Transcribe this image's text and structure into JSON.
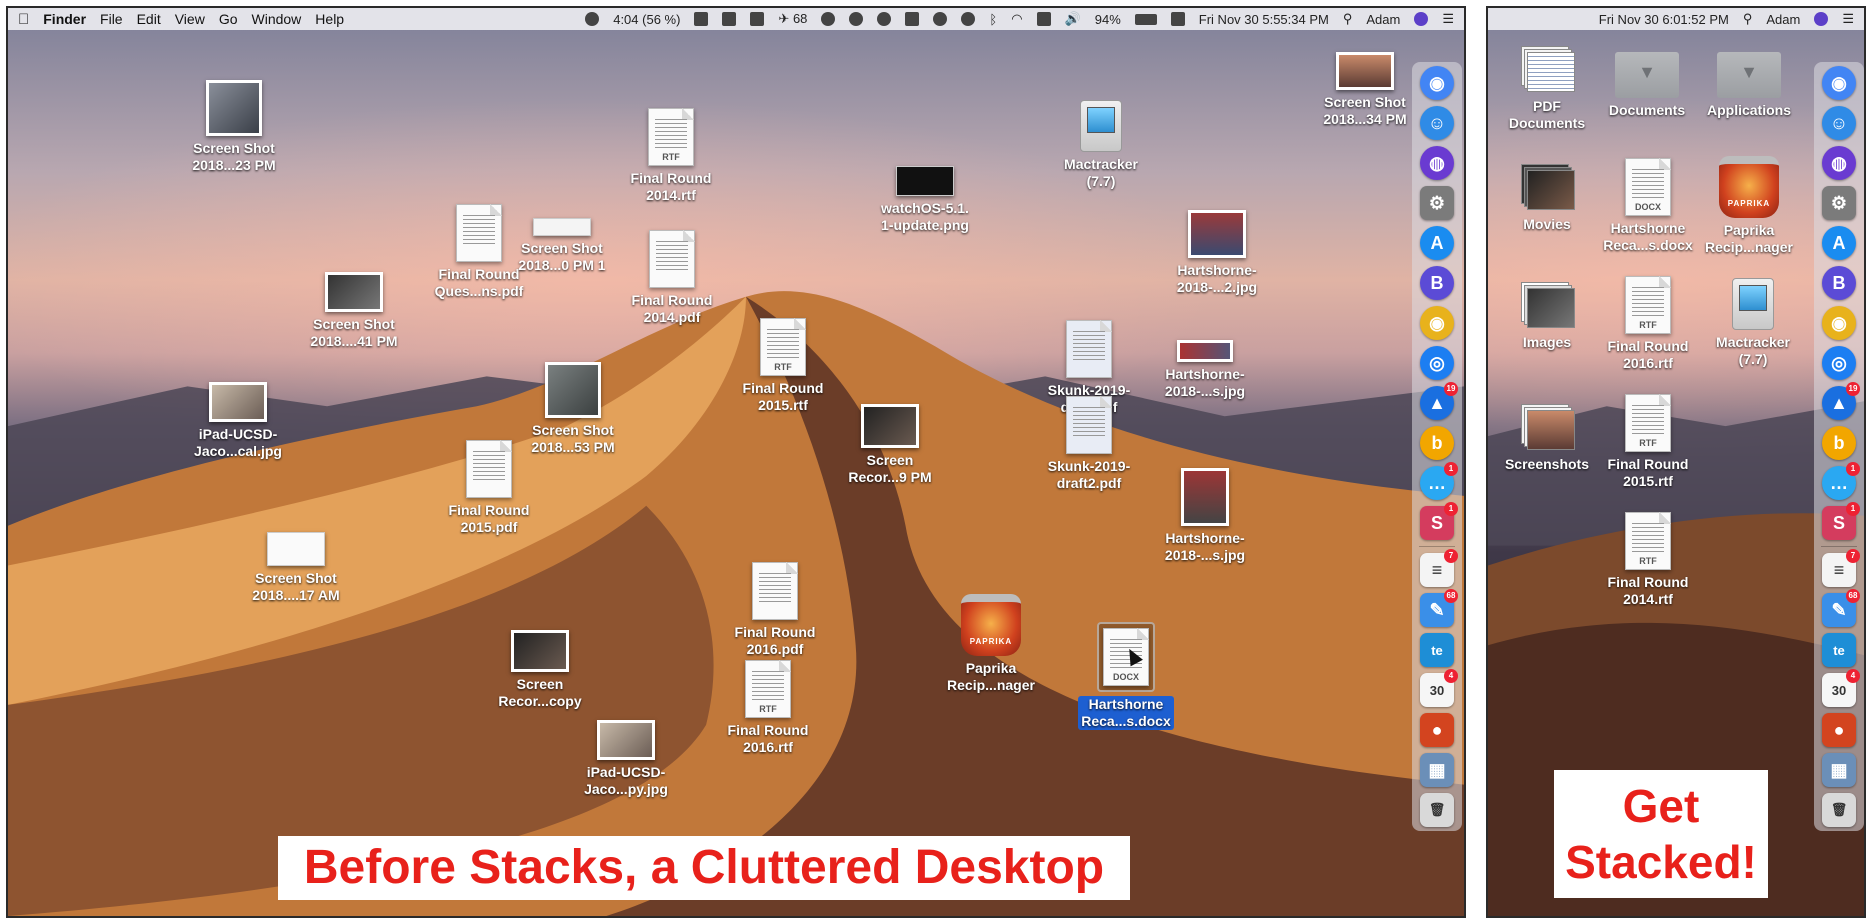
{
  "left_screen": {
    "menubar": {
      "app_name": "Finder",
      "menus": [
        "File",
        "Edit",
        "View",
        "Go",
        "Window",
        "Help"
      ],
      "battery_timer": "4:04 (56 %)",
      "flight_count": "68",
      "battery_percent": "94%",
      "clock": "Fri Nov 30  5:55:34 PM",
      "user": "Adam"
    },
    "desktop_items": [
      {
        "label": "Screen Shot\n2018...23 PM",
        "kind": "photo"
      },
      {
        "label": "Final Round\nQues...ns.pdf",
        "kind": "doc"
      },
      {
        "label": "Screen Shot\n2018...0 PM 1",
        "kind": "screenshot"
      },
      {
        "label": "Final Round\n2014.rtf",
        "kind": "doc",
        "tag": "RTF"
      },
      {
        "label": "Final Round\n2014.pdf",
        "kind": "doc"
      },
      {
        "label": "watchOS-5.1.\n1-update.png",
        "kind": "screenshot"
      },
      {
        "label": "Mactracker\n(7.7)",
        "kind": "app"
      },
      {
        "label": "Screen Shot\n2018...34 PM",
        "kind": "photo"
      },
      {
        "label": "Hartshorne-\n2018-...2.jpg",
        "kind": "photo"
      },
      {
        "label": "Screen Shot\n2018....41 PM",
        "kind": "photo"
      },
      {
        "label": "Final Round\n2015.rtf",
        "kind": "doc",
        "tag": "RTF"
      },
      {
        "label": "Skunk-2019-\ndraft.pdf",
        "kind": "doc"
      },
      {
        "label": "Hartshorne-\n2018-...s.jpg",
        "kind": "photo"
      },
      {
        "label": "iPad-UCSD-\nJaco...cal.jpg",
        "kind": "photo"
      },
      {
        "label": "Screen Shot\n2018...53 PM",
        "kind": "photo"
      },
      {
        "label": "Screen\nRecor...9 PM",
        "kind": "photo"
      },
      {
        "label": "Skunk-2019-\ndraft2.pdf",
        "kind": "doc"
      },
      {
        "label": "Final Round\n2015.pdf",
        "kind": "doc"
      },
      {
        "label": "Hartshorne-\n2018-...s.jpg",
        "kind": "photo"
      },
      {
        "label": "Screen Shot\n2018....17 AM",
        "kind": "screenshot"
      },
      {
        "label": "Final Round\n2016.pdf",
        "kind": "doc"
      },
      {
        "label": "Paprika\nRecip...nager",
        "kind": "app"
      },
      {
        "label": "Hartshorne\nReca...s.docx",
        "kind": "doc",
        "tag": "DOCX"
      },
      {
        "label": "Screen\nRecor...copy",
        "kind": "photo"
      },
      {
        "label": "Final Round\n2016.rtf",
        "kind": "doc",
        "tag": "RTF"
      },
      {
        "label": "iPad-UCSD-\nJaco...py.jpg",
        "kind": "photo"
      }
    ],
    "caption": "Before Stacks, a Cluttered Desktop"
  },
  "right_screen": {
    "menubar": {
      "clock": "Fri Nov 30  6:01:52 PM",
      "user": "Adam"
    },
    "desktop_items": [
      {
        "label": "PDF\nDocuments",
        "kind": "stack"
      },
      {
        "label": "Documents",
        "kind": "folder"
      },
      {
        "label": "Applications",
        "kind": "folder"
      },
      {
        "label": "Movies",
        "kind": "stack"
      },
      {
        "label": "Hartshorne\nReca...s.docx",
        "kind": "doc",
        "tag": "DOCX"
      },
      {
        "label": "Paprika\nRecip...nager",
        "kind": "app"
      },
      {
        "label": "Images",
        "kind": "stack"
      },
      {
        "label": "Final Round\n2016.rtf",
        "kind": "doc",
        "tag": "RTF"
      },
      {
        "label": "Mactracker\n(7.7)",
        "kind": "app"
      },
      {
        "label": "Screenshots",
        "kind": "stack"
      },
      {
        "label": "Final Round\n2015.rtf",
        "kind": "doc",
        "tag": "RTF"
      },
      {
        "label": "Final Round\n2014.rtf",
        "kind": "doc",
        "tag": "RTF"
      }
    ],
    "caption": "Get\nStacked!"
  },
  "dock": {
    "items": [
      {
        "name": "chrome-icon",
        "color": "#4285f4",
        "glyph": "◉"
      },
      {
        "name": "finder-icon",
        "color": "#2f8be6",
        "glyph": "☺"
      },
      {
        "name": "siri-icon",
        "color": "#6a3bd1",
        "glyph": "◍"
      },
      {
        "name": "system-preferences-icon",
        "color": "#7b7b7b",
        "glyph": "⚙"
      },
      {
        "name": "app-store-icon",
        "color": "#1a8cf0",
        "glyph": "A"
      },
      {
        "name": "bbedit-icon",
        "color": "#5b4bd6",
        "glyph": "B"
      },
      {
        "name": "chrome-canary-icon",
        "color": "#e8b21c",
        "glyph": "◉"
      },
      {
        "name": "safari-icon",
        "color": "#1c7ef2",
        "glyph": "◎"
      },
      {
        "name": "airmail-icon",
        "color": "#1a6fe0",
        "glyph": "▲",
        "badge": "19"
      },
      {
        "name": "bing-icon",
        "color": "#f2a600",
        "glyph": "b"
      },
      {
        "name": "messages-icon",
        "color": "#2aa8f2",
        "glyph": "…",
        "badge": "1"
      },
      {
        "name": "slack-icon",
        "color": "#d43c5e",
        "glyph": "S",
        "badge": "1"
      },
      {
        "name": "reminders-icon",
        "color": "#f4f4f4",
        "glyph": "≡",
        "badge": "7",
        "dark": true
      },
      {
        "name": "mail-icon",
        "color": "#3a8fe8",
        "glyph": "✎",
        "badge": "68"
      },
      {
        "name": "textexpander-icon",
        "color": "#1e8ed6",
        "glyph": "te"
      },
      {
        "name": "calendar-icon",
        "color": "#f6f6f6",
        "glyph": "30",
        "badge": "4",
        "dark": true
      },
      {
        "name": "paprika-icon",
        "color": "#d3441f",
        "glyph": "●"
      },
      {
        "name": "preview-icon",
        "color": "#6b8fb8",
        "glyph": "▦"
      },
      {
        "name": "trash-icon",
        "color": "#d9d9d9",
        "glyph": "🗑",
        "dark": true
      }
    ]
  },
  "colors": {
    "caption_text": "#e8211b",
    "selection": "#1d5fd1"
  }
}
